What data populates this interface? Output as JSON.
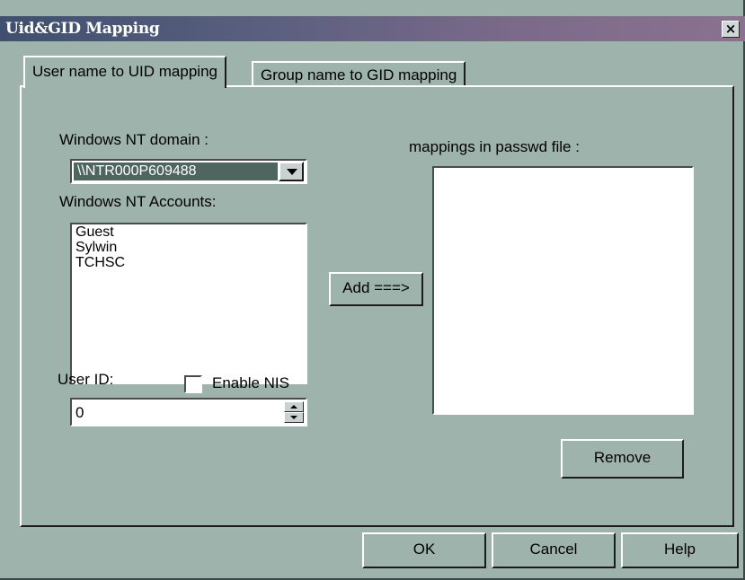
{
  "window": {
    "title": "Uid&GID Mapping",
    "close_label": "×"
  },
  "tabs": [
    {
      "label": "User name to UID mapping",
      "active": true
    },
    {
      "label": "Group name to GID mapping",
      "active": false
    }
  ],
  "domain": {
    "label": "Windows NT domain :",
    "selected": "\\\\NTR000P609488"
  },
  "accounts": {
    "label": "Windows NT Accounts:",
    "items": [
      "Guest",
      "Sylwin",
      "TCHSC"
    ]
  },
  "user_id": {
    "label": "User ID:",
    "value": "0"
  },
  "enable_nis": {
    "label": "Enable NIS",
    "checked": false
  },
  "add_button": "Add ===>",
  "mappings": {
    "label": "mappings in passwd file :",
    "items": []
  },
  "remove_button": "Remove",
  "footer": {
    "ok": "OK",
    "cancel": "Cancel",
    "help": "Help"
  },
  "icons": {
    "combo_arrow": "chevron-down-icon",
    "spin_up": "spin-up-icon",
    "spin_down": "spin-down-icon",
    "close": "close-icon"
  },
  "colors": {
    "dialog_bg": "#9fb3ad",
    "title_start": "#3f4f6e",
    "title_end": "#8a7290",
    "selection": "#4e6560"
  }
}
